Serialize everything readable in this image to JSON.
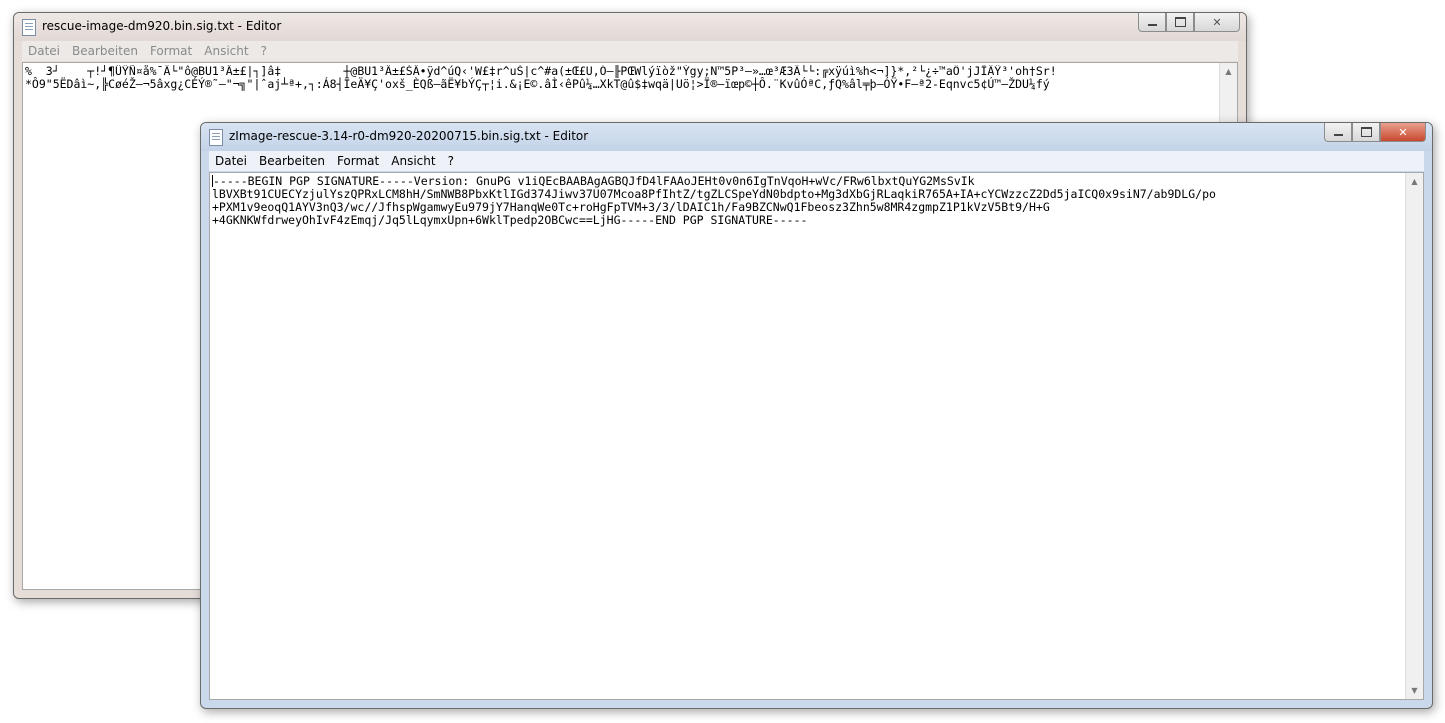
{
  "windows": {
    "back": {
      "title": "rescue-image-dm920.bin.sig.txt - Editor",
      "menu": [
        "Datei",
        "Bearbeiten",
        "Format",
        "Ansicht",
        "?"
      ],
      "lines": [
        "%  3┘    ┬!┘¶ÜŸÑ¤å%¯Ä└\"ô@BU1³Â±£|┐]â‡         ┼@BU1³Â±£ŠÂ•ÿd^úQ‹'W£‡r^uŠ|c^#a(±Œ£U,Ó–╟PŒWlýïòž\"Ýgy;N™5P³–»…œ³Æ3Ä└└:╔xÿúì%h<¬]}*,²└¿÷™aÔ'jJÎÄŸ³'oh†Sr!",
        "*Ô9\"5ËDâì~,╠CøéŽ–¬5âxg¿CÉÝ®˜–\"¬╗\"|ˆaj┴ª+,┐:Á8┤ÏeÄ¥Ç'oxš_ÈQß–ãË¥bÝÇ┬¦i.&¡E©.âÌ‹êPû¼…XkT@û$‡wqä|Uö¦>Ï®–ïœp©┼Ô.¨KvûÓªC,ƒQ%âl╤þ–ÓŸ•F–ª2-Eqnvc5¢Ú™–ŽDU¼fý"
      ]
    },
    "front": {
      "title": "zImage-rescue-3.14-r0-dm920-20200715.bin.sig.txt - Editor",
      "menu": [
        "Datei",
        "Bearbeiten",
        "Format",
        "Ansicht",
        "?"
      ],
      "lines": [
        "-----BEGIN PGP SIGNATURE-----Version: GnuPG v1iQEcBAABAgAGBQJfD4lFAAoJEHt0v0n6IgTnVqoH+wVc/FRw6lbxtQuYG2MsSvIk",
        "lBVXBt91CUECYzjulYszQPRxLCM8hH/SmNWB8PbxKtlIGd374Jiwv37U07Mcoa8PfIhtZ/tgZLCSpeYdN0bdpto+Mg3dXbGjRLaqkiR765A+IA+cYCWzzcZ2Dd5jaICQ0x9siN7/ab9DLG/po",
        "+PXM1v9eoqQ1AYV3nQ3/wc//JfhspWgamwyEu979jY7HanqWe0Tc+roHgFpTVM+3/3/lDAIC1h/Fa9BZCNwQ1Fbeosz3Zhn5w8MR4zgmpZ1P1kVzV5Bt9/H+G",
        "+4GKNKWfdrweyOhIvF4zEmqj/Jq5lLqymxUpn+6WklTpedp2OBCwc==LjHG-----END PGP SIGNATURE-----"
      ]
    }
  },
  "icons": {
    "window_icon": "notepad-icon",
    "minimize": "minimize-icon",
    "maximize": "maximize-icon",
    "close": "close-icon",
    "scroll_up": "scroll-up-arrow-icon",
    "scroll_down": "scroll-down-arrow-icon"
  },
  "colors": {
    "active_titlebar": "#c9d8ea",
    "inactive_titlebar": "#e6ddd9",
    "close_active": "#c8492f"
  }
}
